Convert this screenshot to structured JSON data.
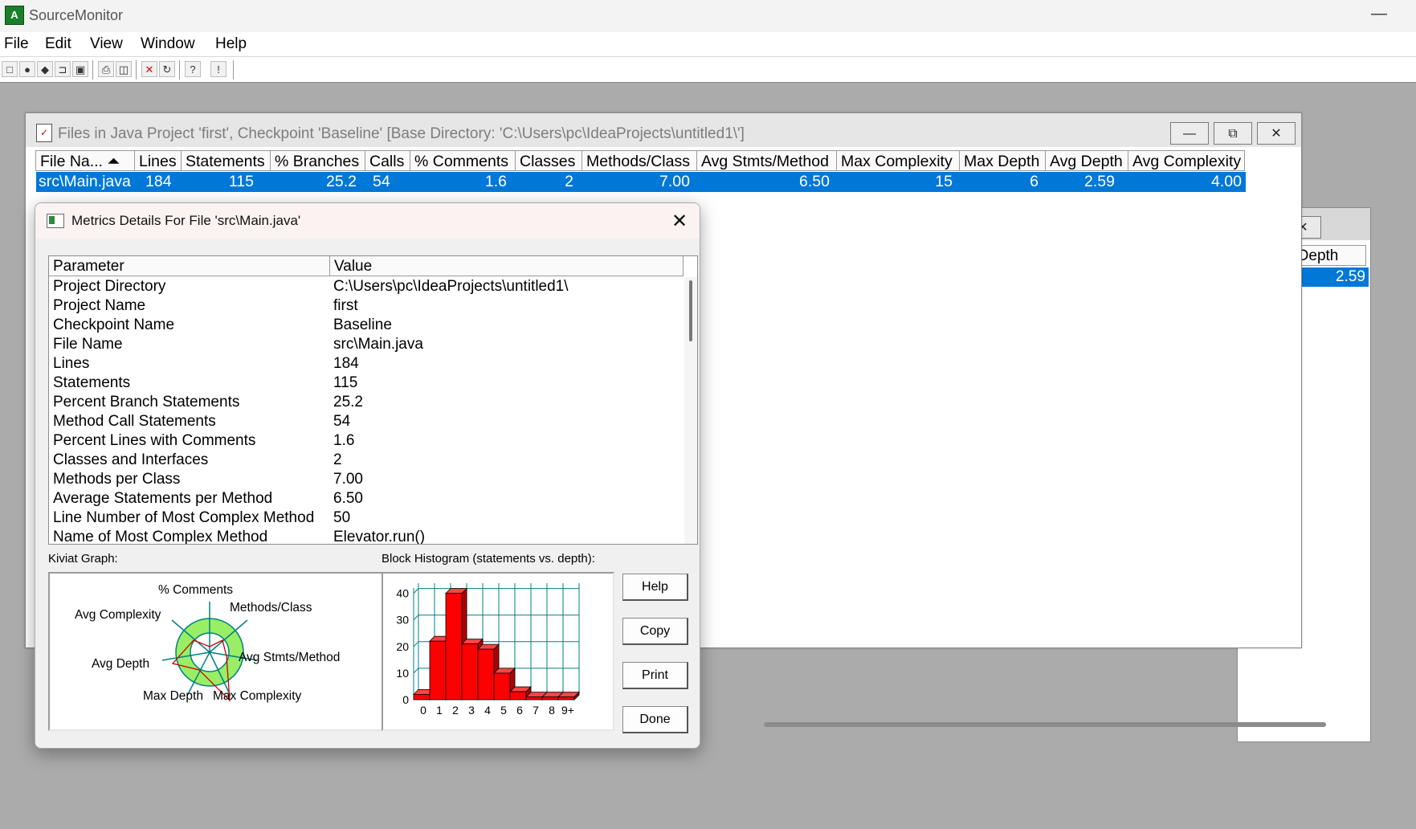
{
  "app": {
    "title": "SourceMonitor",
    "minimize": "—"
  },
  "menu": [
    "File",
    "Edit",
    "View",
    "Window",
    "Help"
  ],
  "toolbar": [
    "new-icon",
    "open-project-icon",
    "checkpoint-icon",
    "open-icon",
    "save-icon",
    "print-icon",
    "print-preview-icon",
    "delete-icon",
    "refresh-icon",
    "help-context-icon",
    "about-icon"
  ],
  "files_window": {
    "title": "Files in Java Project 'first', Checkpoint 'Baseline'  [Base Directory: 'C:\\Users\\pc\\IdeaProjects\\untitled1\\']",
    "columns": [
      "File Na... ⏶",
      "Lines",
      "Statements",
      "% Branches",
      "Calls",
      "% Comments",
      "Classes",
      "Methods/Class",
      "Avg Stmts/Method",
      "Max Complexity",
      "Max Depth",
      "Avg Depth",
      "Avg Complexity"
    ],
    "row": [
      "src\\Main.java",
      "184",
      "115",
      "25.2",
      "54",
      "1.6",
      "2",
      "7.00",
      "6.50",
      "15",
      "6",
      "2.59",
      "4.00"
    ]
  },
  "background_window": {
    "header": "Avg Depth",
    "value": "2.59"
  },
  "dialog": {
    "title": "Metrics Details For File 'src\\Main.java'",
    "close": "✕",
    "param_header": "Parameter",
    "value_header": "Value",
    "params": [
      {
        "name": "Project Directory",
        "value": "C:\\Users\\pc\\IdeaProjects\\untitled1\\"
      },
      {
        "name": "Project Name",
        "value": "first"
      },
      {
        "name": "Checkpoint Name",
        "value": "Baseline"
      },
      {
        "name": "File Name",
        "value": "src\\Main.java"
      },
      {
        "name": "Lines",
        "value": "184"
      },
      {
        "name": "Statements",
        "value": "115"
      },
      {
        "name": "Percent Branch Statements",
        "value": "25.2"
      },
      {
        "name": "Method Call Statements",
        "value": "54"
      },
      {
        "name": "Percent Lines with Comments",
        "value": "1.6"
      },
      {
        "name": "Classes and Interfaces",
        "value": "2"
      },
      {
        "name": "Methods per Class",
        "value": "7.00"
      },
      {
        "name": "Average Statements per Method",
        "value": "6.50"
      },
      {
        "name": "Line Number of Most Complex Method",
        "value": "50"
      },
      {
        "name": "Name of Most Complex Method",
        "value": "Elevator.run()"
      }
    ],
    "kiviat_label": "Kiviat Graph:",
    "kiviat_axes": [
      "% Comments",
      "Methods/Class",
      "Avg Stmts/Method",
      "Max Complexity",
      "Max Depth",
      "Avg Depth",
      "Avg Complexity"
    ],
    "histogram_label": "Block Histogram (statements vs. depth):",
    "buttons": {
      "help": "Help",
      "copy": "Copy",
      "print": "Print",
      "done": "Done"
    }
  },
  "chart_data": {
    "type": "bar",
    "title": "Block Histogram (statements vs. depth):",
    "categories": [
      "0",
      "1",
      "2",
      "3",
      "4",
      "5",
      "6",
      "7",
      "8",
      "9+"
    ],
    "values": [
      2,
      22,
      40,
      21,
      19,
      10,
      3,
      1,
      1,
      1
    ],
    "yticks": [
      "0",
      "10",
      "20",
      "30",
      "40"
    ],
    "ylim": [
      0,
      42
    ],
    "grid": true,
    "bar_color": "#ff0000",
    "grid_color": "#008080"
  },
  "colors": {
    "selection": "#0078d7",
    "kiviat_band": "#99ee66",
    "axis": "#008080"
  }
}
